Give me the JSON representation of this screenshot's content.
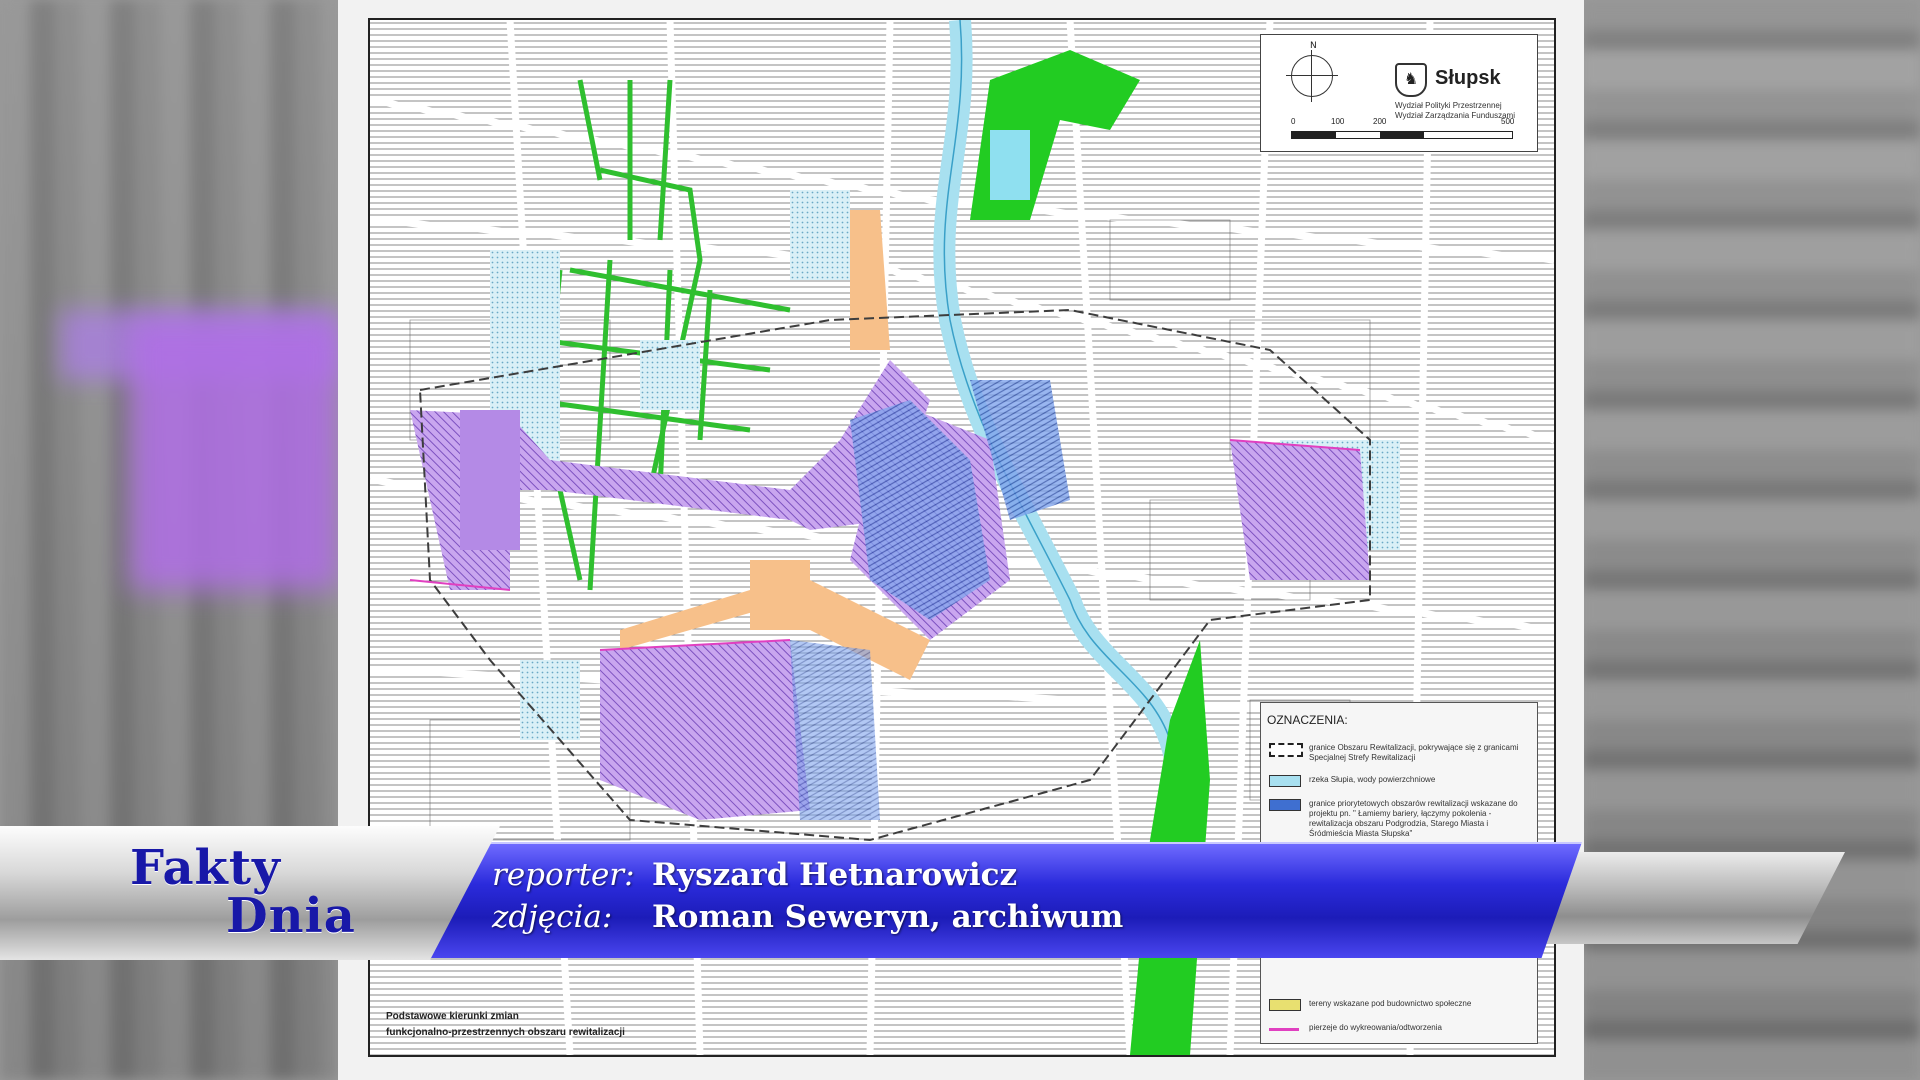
{
  "map": {
    "city_name": "Słupsk",
    "department_lines": [
      "Wydział Polityki Przestrzennej",
      "Wydział Zarządzania Funduszami"
    ],
    "compass_label": "N",
    "scale_labels": [
      "0",
      "100",
      "200",
      "500"
    ],
    "caption_lines": [
      "Podstawowe kierunki zmian",
      "funkcjonalno-przestrzennych obszaru rewitalizacji"
    ],
    "legend": {
      "title": "OZNACZENIA:",
      "items": [
        {
          "text": "granice Obszaru Rewitalizacji, pokrywające się z granicami Specjalnej Strefy Rewitalizacji",
          "swatch": "#ffffff"
        },
        {
          "text": "rzeka Słupia, wody powierzchniowe",
          "swatch": "#a8e0f0"
        },
        {
          "text": "granice priorytetowych obszarów rewitalizacji wskazane do projektu pn. \" Łamiemy bariery, łączymy pokolenia - rewitalizacja obszaru Podgrodzia, Starego Miasta i Śródmieścia Miasta Słupska\"",
          "swatch": "#3f6fd0"
        },
        {
          "text": "tereny wskazane pod budownictwo społeczne",
          "swatch": "#e8e070"
        },
        {
          "text": "pierzeje do wykreowania/odtworzenia",
          "swatch": "#e040c0"
        }
      ]
    }
  },
  "banner": {
    "brand_line1": "Fakty",
    "brand_line2": "Dnia",
    "reporter_label": "reporter:",
    "reporter_name": "Ryszard Hetnarowicz",
    "photos_label": "zdjęcia:",
    "photos_name": "Roman Seweryn, archiwum"
  },
  "colors": {
    "banner_blue": "#2b2bdc",
    "brand_text": "#1818a8",
    "river": "#a8e0f0",
    "green_area": "#22cc22",
    "purple_area": "#b48ae6",
    "orange_area": "#f7c08a",
    "priority_blue": "#3f6fd0"
  }
}
